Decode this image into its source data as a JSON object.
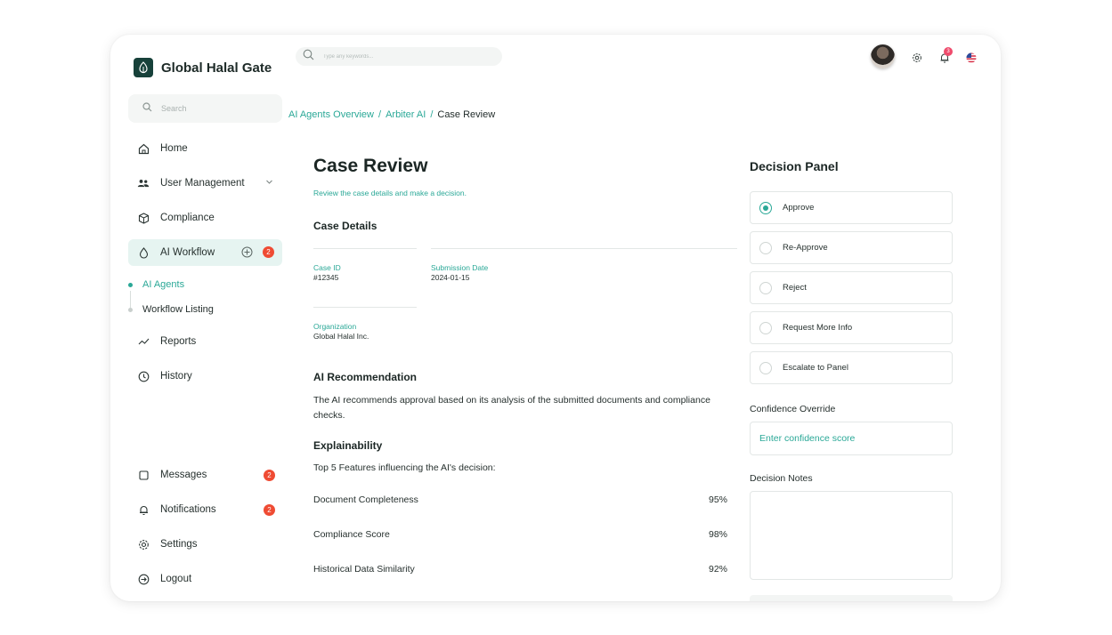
{
  "brand": {
    "name": "Global Halal Gate"
  },
  "topbar": {
    "search_placeholder": "Type any keywords...",
    "bell_count": "3"
  },
  "sidebar": {
    "search_placeholder": "Search",
    "items": [
      {
        "label": "Home"
      },
      {
        "label": "User Management"
      },
      {
        "label": "Compliance"
      },
      {
        "label": "AI Workflow",
        "badge": "2"
      },
      {
        "label": "Reports"
      },
      {
        "label": "History"
      },
      {
        "label": "Messages",
        "badge": "2"
      },
      {
        "label": "Notifications",
        "badge": "2"
      },
      {
        "label": "Settings"
      },
      {
        "label": "Logout"
      }
    ],
    "sub_items": [
      {
        "label": "AI Agents"
      },
      {
        "label": "Workflow Listing"
      }
    ]
  },
  "breadcrumb": {
    "items": [
      "AI Agents Overview",
      "Arbiter AI",
      "Case Review"
    ],
    "separator": "/"
  },
  "main": {
    "title": "Case Review",
    "subtitle": "Review the case details and make a decision.",
    "case_details": {
      "heading": "Case Details",
      "case_id_label": "Case ID",
      "case_id": "#12345",
      "submission_date_label": "Submission Date",
      "submission_date": "2024-01-15",
      "organization_label": "Organization",
      "organization": "Global Halal Inc."
    },
    "ai_recommendation": {
      "heading": "AI Recommendation",
      "text": "The AI recommends approval based on its analysis of the submitted documents and compliance checks."
    },
    "explainability": {
      "heading": "Explainability",
      "intro": "Top 5 Features influencing the AI's decision:",
      "features": [
        {
          "name": "Document Completeness",
          "value": "95%"
        },
        {
          "name": "Compliance Score",
          "value": "98%"
        },
        {
          "name": "Historical Data Similarity",
          "value": "92%"
        }
      ]
    }
  },
  "decision_panel": {
    "title": "Decision Panel",
    "options": [
      "Approve",
      "Re-Approve",
      "Reject",
      "Request More Info",
      "Escalate to Panel"
    ],
    "selected": "Approve",
    "confidence_label": "Confidence Override",
    "confidence_placeholder": "Enter confidence score",
    "notes_label": "Decision Notes"
  },
  "colors": {
    "accent": "#2aa897",
    "badge": "#ef4b33",
    "brand_dark": "#17413a"
  }
}
